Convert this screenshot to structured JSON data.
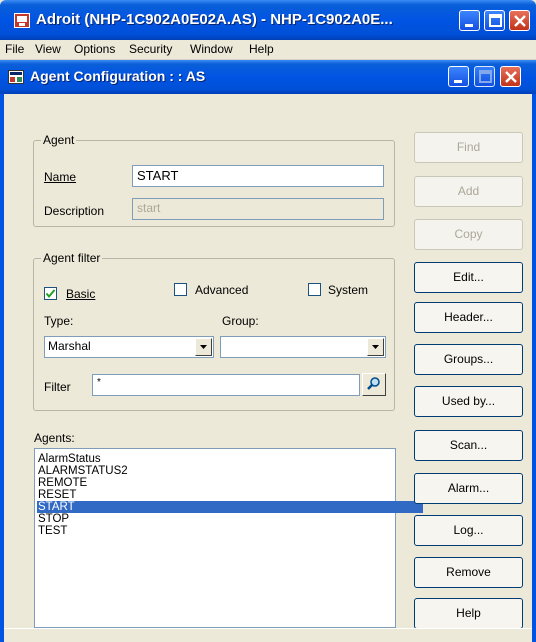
{
  "window": {
    "title": "Adroit (NHP-1C902A0E02A.AS) - NHP-1C902A0E..."
  },
  "menu": [
    "File",
    "View",
    "Options",
    "Security",
    "Window",
    "Help"
  ],
  "dialog": {
    "title": "Agent Configuration :  : AS"
  },
  "agent_group": {
    "legend": "Agent",
    "name_label": "Name",
    "name_value": "START",
    "description_label": "Description",
    "description_value": "start"
  },
  "filter_group": {
    "legend": "Agent filter",
    "basic_label": "Basic",
    "basic_checked": true,
    "advanced_label": "Advanced",
    "advanced_checked": false,
    "system_label": "System",
    "system_checked": false,
    "type_label": "Type:",
    "type_value": "Marshal",
    "group_label": "Group:",
    "group_value": "",
    "filter_label": "Filter",
    "filter_value": "*"
  },
  "agents": {
    "label": "Agents:",
    "items": [
      "AlarmStatus",
      "ALARMSTATUS2",
      "REMOTE",
      "RESET",
      "START",
      "STOP",
      "TEST"
    ],
    "selected": "START"
  },
  "buttons": {
    "find": "Find",
    "add": "Add",
    "copy": "Copy",
    "edit": "Edit...",
    "header": "Header...",
    "groups": "Groups...",
    "used_by": "Used by...",
    "scan": "Scan...",
    "alarm": "Alarm...",
    "log": "Log...",
    "remove": "Remove",
    "help": "Help"
  },
  "colors": {
    "titlebar": "#0054e3",
    "selection": "#316ac5",
    "face": "#ece9d8"
  }
}
